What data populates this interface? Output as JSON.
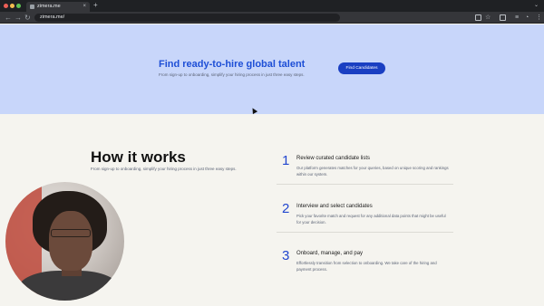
{
  "browser": {
    "tab_title": "zimera.me",
    "tab_close": "×",
    "new_tab": "+",
    "url": "zimera.me/",
    "back": "←",
    "forward": "→",
    "reload": "↻",
    "menu": "⋮"
  },
  "hero": {
    "title": "Find ready-to-hire global talent",
    "subtitle": "From sign-up to onboarding, simplify your hiring process in just three easy steps.",
    "cta_label": "Find Candidates",
    "bg_color": "#c8d6fa",
    "accent": "#1e4fd6"
  },
  "how_it_works": {
    "title": "How it works",
    "subtitle": "From sign-up to onboarding, simplify your hiring process in just three easy steps.",
    "steps": [
      {
        "number": "1",
        "title": "Review curated candidate lists",
        "description": "Our platform generates matches for your queries, based on unique scoring and rankings within our system."
      },
      {
        "number": "2",
        "title": "Interview and select candidates",
        "description": "Pick your favorite match and request for any additional data points that might be useful for your decision."
      },
      {
        "number": "3",
        "title": "Onboard, manage, and pay",
        "description": "Effortlessly transition from selection to onboarding. We take care of the hiring and payment process."
      }
    ]
  }
}
